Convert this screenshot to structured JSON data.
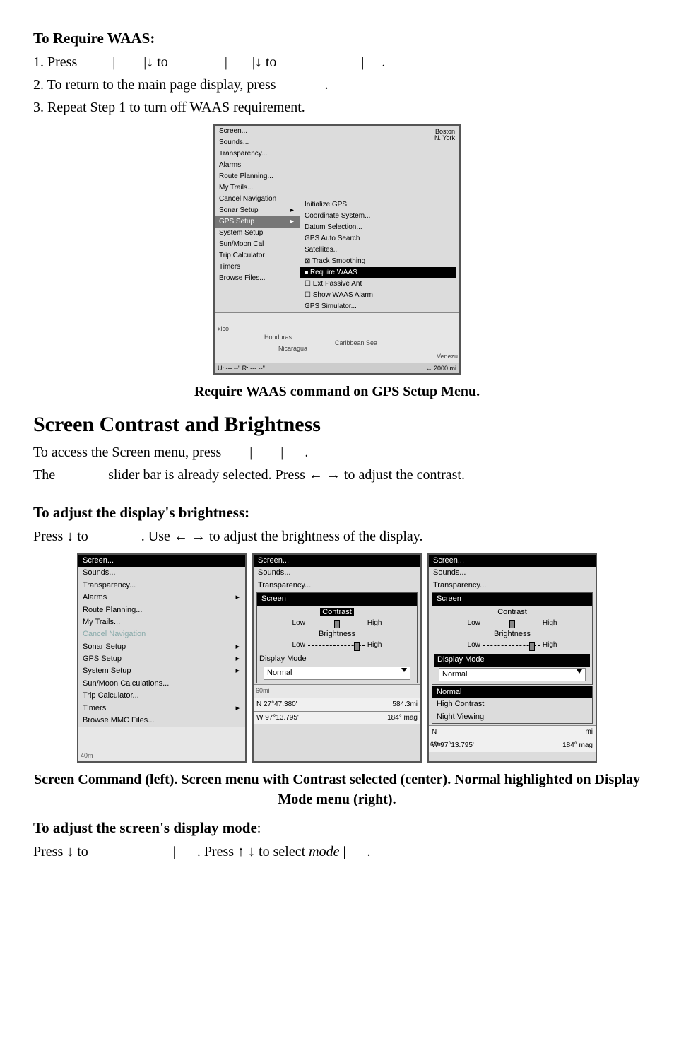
{
  "sec1": {
    "heading": "To Require WAAS:",
    "step1a": "1. Press ",
    "step1b": "|",
    "step1c": "|↓ to ",
    "step1d": "|",
    "step1e": "|↓ to ",
    "step1f": "|",
    "step1g": ".",
    "step2a": "2. To return to the main page display, press ",
    "step2b": "|",
    "step2c": ".",
    "step3": "3. Repeat Step 1 to turn off WAAS requirement.",
    "caption1": "Require WAAS command on GPS Setup Menu."
  },
  "sec2": {
    "heading": "Screen Contrast and Brightness",
    "line1a": "To access the Screen menu, press ",
    "line1b": "|",
    "line1c": "|",
    "line1d": ".",
    "line2a": "The ",
    "line2b": " slider bar is already selected. Press ← → to adjust the contrast.",
    "sub1": "To adjust the display's brightness:",
    "sub1la": "Press ↓ to ",
    "sub1lb": ". Use ← → to adjust the brightness of the display.",
    "caption2": "Screen Command (left). Screen menu with Contrast selected (center). Normal highlighted on Display Mode menu (right).",
    "sub2": "To adjust the screen's display mode",
    "sub2colon": ":",
    "sub2la": "Press ↓ to ",
    "sub2lb": "|",
    "sub2lc": ". Press ↑ ↓ to select ",
    "sub2ld": "mode",
    "sub2le": "|",
    "sub2lf": "."
  },
  "panelA": {
    "leftItems": [
      "Screen...",
      "Sounds...",
      "Transparency...",
      "Alarms",
      "Route Planning...",
      "My Trails...",
      "Cancel Navigation",
      "Sonar Setup"
    ],
    "leftSelected": "GPS Setup",
    "leftItems2": [
      "System Setup",
      "Sun/Moon Cal",
      "Trip Calculator",
      "Timers",
      "Browse Files..."
    ],
    "rightTop": [
      "Initialize GPS",
      "Coordinate System...",
      "Datum Selection...",
      "GPS Auto Search",
      "Satellites..."
    ],
    "rightCheck1": "Track Smoothing",
    "rightSelected": "Require WAAS",
    "rightCheck2": "Ext Passive Ant",
    "rightCheck3": "Show WAAS Alarm",
    "rightLast": "GPS Simulator...",
    "mapLabels": {
      "boston": "Boston",
      "york": "N. York",
      "xico": "xico",
      "honduras": "Honduras",
      "nicaragua": "Nicaragua",
      "carib": "Caribbean Sea",
      "venez": "Venezu"
    },
    "footerL": "U: ---.--\"   R: ---.--\"",
    "footerR": "↔ 2000 mi"
  },
  "panelLeft": {
    "highlight": "Screen...",
    "items": [
      "Sounds...",
      "Transparency...",
      "Alarms",
      "Route Planning...",
      "My Trails..."
    ],
    "grayItem": "Cancel Navigation",
    "items2": [
      "Sonar Setup",
      "GPS Setup",
      "System Setup",
      "Sun/Moon Calculations...",
      "Trip Calculator...",
      "Timers",
      "Browse MMC Files..."
    ],
    "mapLabel": "40m"
  },
  "panelMid": {
    "highlight": "Screen...",
    "items": [
      "Sounds...",
      "Transparency..."
    ],
    "boxTitle": "Screen",
    "contrastLabel": "Contrast",
    "brightLabel": "Brightness",
    "low": "Low",
    "high": "High",
    "dispMode": "Display Mode",
    "dispValue": "Normal",
    "mapLabel": "60mi",
    "coord1": "N  27°47.380'",
    "coord2": "W  97°13.795'",
    "dist": "584.3mi",
    "bearing": "184° mag"
  },
  "panelRight": {
    "highlight": "Screen...",
    "items": [
      "Sounds...",
      "Transparency..."
    ],
    "boxTitle": "Screen",
    "contrastLabel": "Contrast",
    "brightLabel": "Brightness",
    "low": "Low",
    "high": "High",
    "dispMode": "Display Mode",
    "dispValue": "Normal",
    "ddItems": [
      "Normal",
      "High Contrast",
      "Night Viewing"
    ],
    "mapLabel": "60m",
    "coord2": "W  97°13.795'",
    "bearing": "184° mag",
    "tinyN": "N",
    "tinyMi": "mi"
  }
}
